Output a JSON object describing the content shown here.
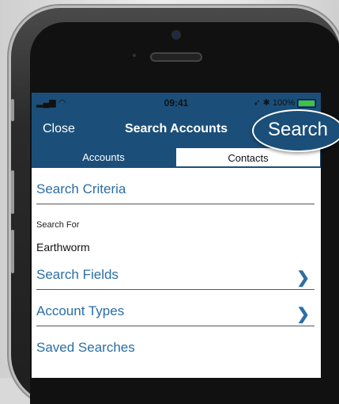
{
  "status_bar": {
    "signal": "▂▄▆ ◠",
    "time": "09:41",
    "right": "➶ ✱ 100%"
  },
  "nav": {
    "close_label": "Close",
    "title": "Search Accounts",
    "search_label": "Search"
  },
  "tabs": [
    {
      "label": "Accounts",
      "active": true
    },
    {
      "label": "Contacts",
      "active": false
    }
  ],
  "form": {
    "search_criteria_title": "Search Criteria",
    "search_for_label": "Search For",
    "search_for_value": "Earthworm",
    "search_fields_label": "Search Fields",
    "account_types_label": "Account Types",
    "saved_searches_label": "Saved Searches"
  },
  "icons": {
    "chevron": "chevron-right-icon"
  },
  "colors": {
    "brand": "#1b4f79",
    "link": "#2a6ea6"
  }
}
